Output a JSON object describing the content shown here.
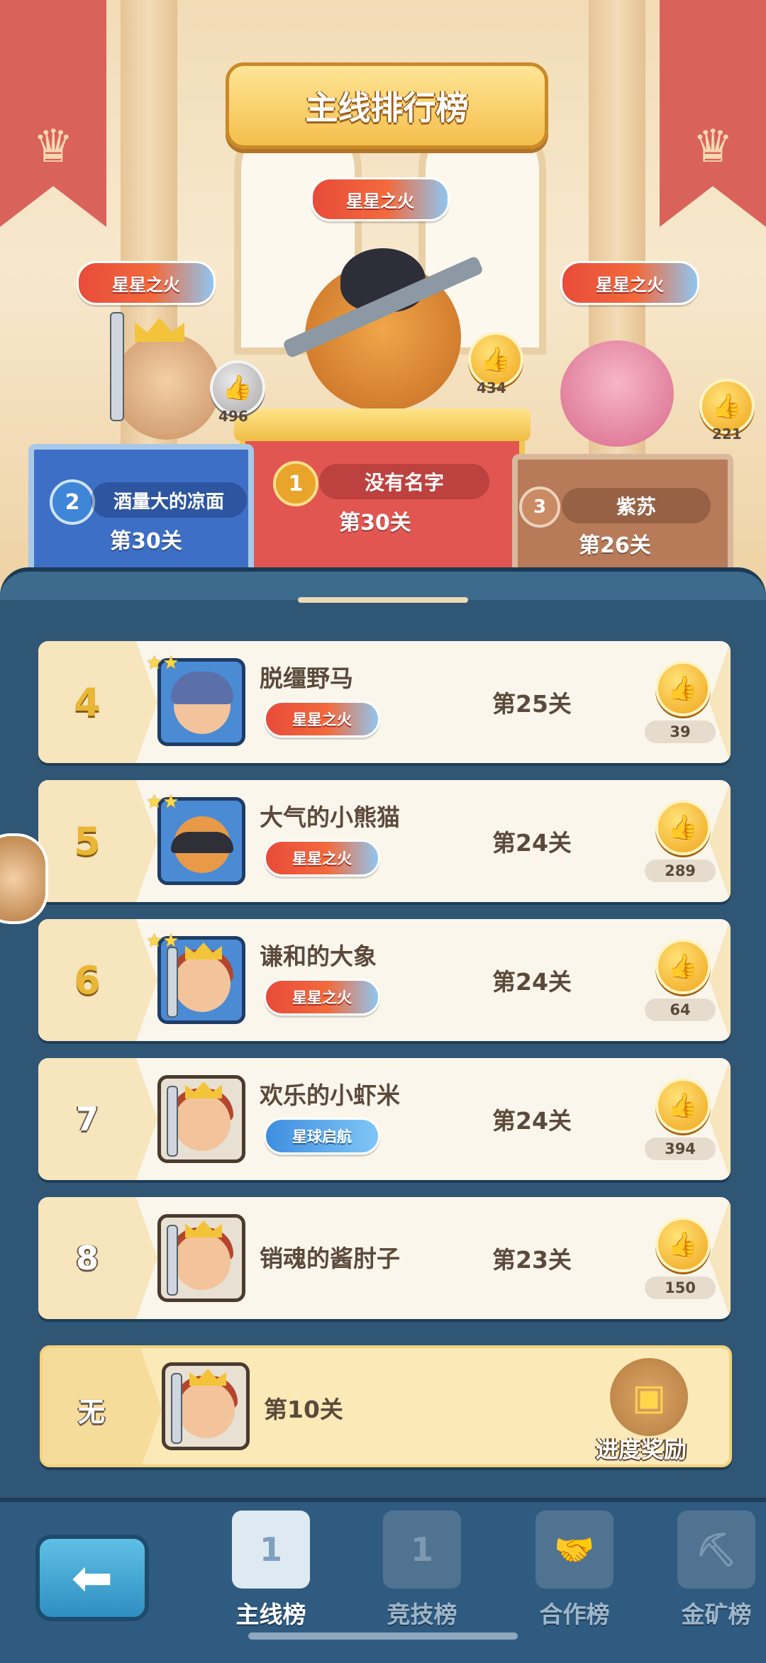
{
  "title": "主线排行榜",
  "podium": {
    "first": {
      "rank": "1",
      "name": "没有名字",
      "level": "第30关",
      "badge": "星星之火",
      "likes": "434"
    },
    "second": {
      "rank": "2",
      "name": "酒量大的凉面",
      "level": "第30关",
      "badge": "星星之火",
      "likes": "496"
    },
    "third": {
      "rank": "3",
      "name": "紫苏",
      "level": "第26关",
      "badge": "星星之火",
      "likes": "221"
    }
  },
  "rows": [
    {
      "rank": "4",
      "name": "脱缰野马",
      "badge": "星星之火",
      "level": "第25关",
      "likes": "39"
    },
    {
      "rank": "5",
      "name": "大气的小熊猫",
      "badge": "星星之火",
      "level": "第24关",
      "likes": "289"
    },
    {
      "rank": "6",
      "name": "谦和的大象",
      "badge": "星星之火",
      "level": "第24关",
      "likes": "64"
    },
    {
      "rank": "7",
      "name": "欢乐的小虾米",
      "badge": "星球启航",
      "level": "第24关",
      "likes": "394"
    },
    {
      "rank": "8",
      "name": "销魂的酱肘子",
      "badge": "",
      "level": "第23关",
      "likes": "150"
    }
  ],
  "me": {
    "rank": "无",
    "level": "第10关",
    "reward_label": "进度奖励"
  },
  "tabs": [
    {
      "label": "主线榜",
      "icon": "podium-icon"
    },
    {
      "label": "竞技榜",
      "icon": "rank-flag-icon"
    },
    {
      "label": "合作榜",
      "icon": "handshake-icon"
    },
    {
      "label": "金矿榜",
      "icon": "mine-cart-icon"
    }
  ],
  "colors": {
    "panel": "#2f5674",
    "gold": "#e9b636",
    "badge_red": "#e84b3a",
    "badge_blue": "#3f8ee0"
  }
}
